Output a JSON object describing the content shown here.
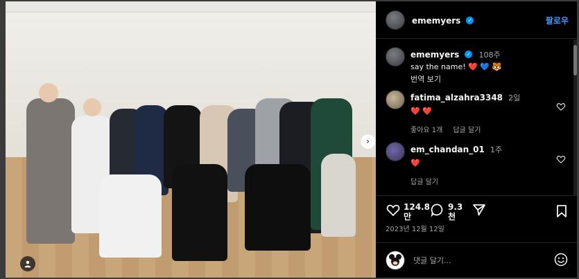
{
  "post": {
    "author": "ememyers",
    "follow_label": "팔로우",
    "caption_author": "ememyers",
    "caption_age": "108주",
    "caption_text": "say the name! ❤️ 💙 🐯",
    "translate_label": "번역 보기",
    "likes_count": "124.8\n만",
    "comments_count": "9.3\n천",
    "date": "2023년 12월 12일",
    "add_comment_placeholder": "댓글 달기..."
  },
  "comments": [
    {
      "author": "fatima_alzahra3348",
      "age": "2일",
      "text": "❤️ ❤️",
      "likes_label": "좋아요 1개",
      "reply_label": "답글 달기"
    },
    {
      "author": "em_chandan_01",
      "age": "1주",
      "text": "❤️",
      "reply_label": "답글 달기"
    }
  ],
  "colors": {
    "accent": "#4a9dff",
    "verified": "#0095f6",
    "heart": "#ed4956"
  },
  "icons": {
    "next": "chevron-right-icon",
    "tag": "user-tag-icon",
    "like": "heart-icon",
    "comment": "comment-icon",
    "share": "share-icon",
    "save": "bookmark-icon",
    "emoji": "emoji-icon"
  }
}
